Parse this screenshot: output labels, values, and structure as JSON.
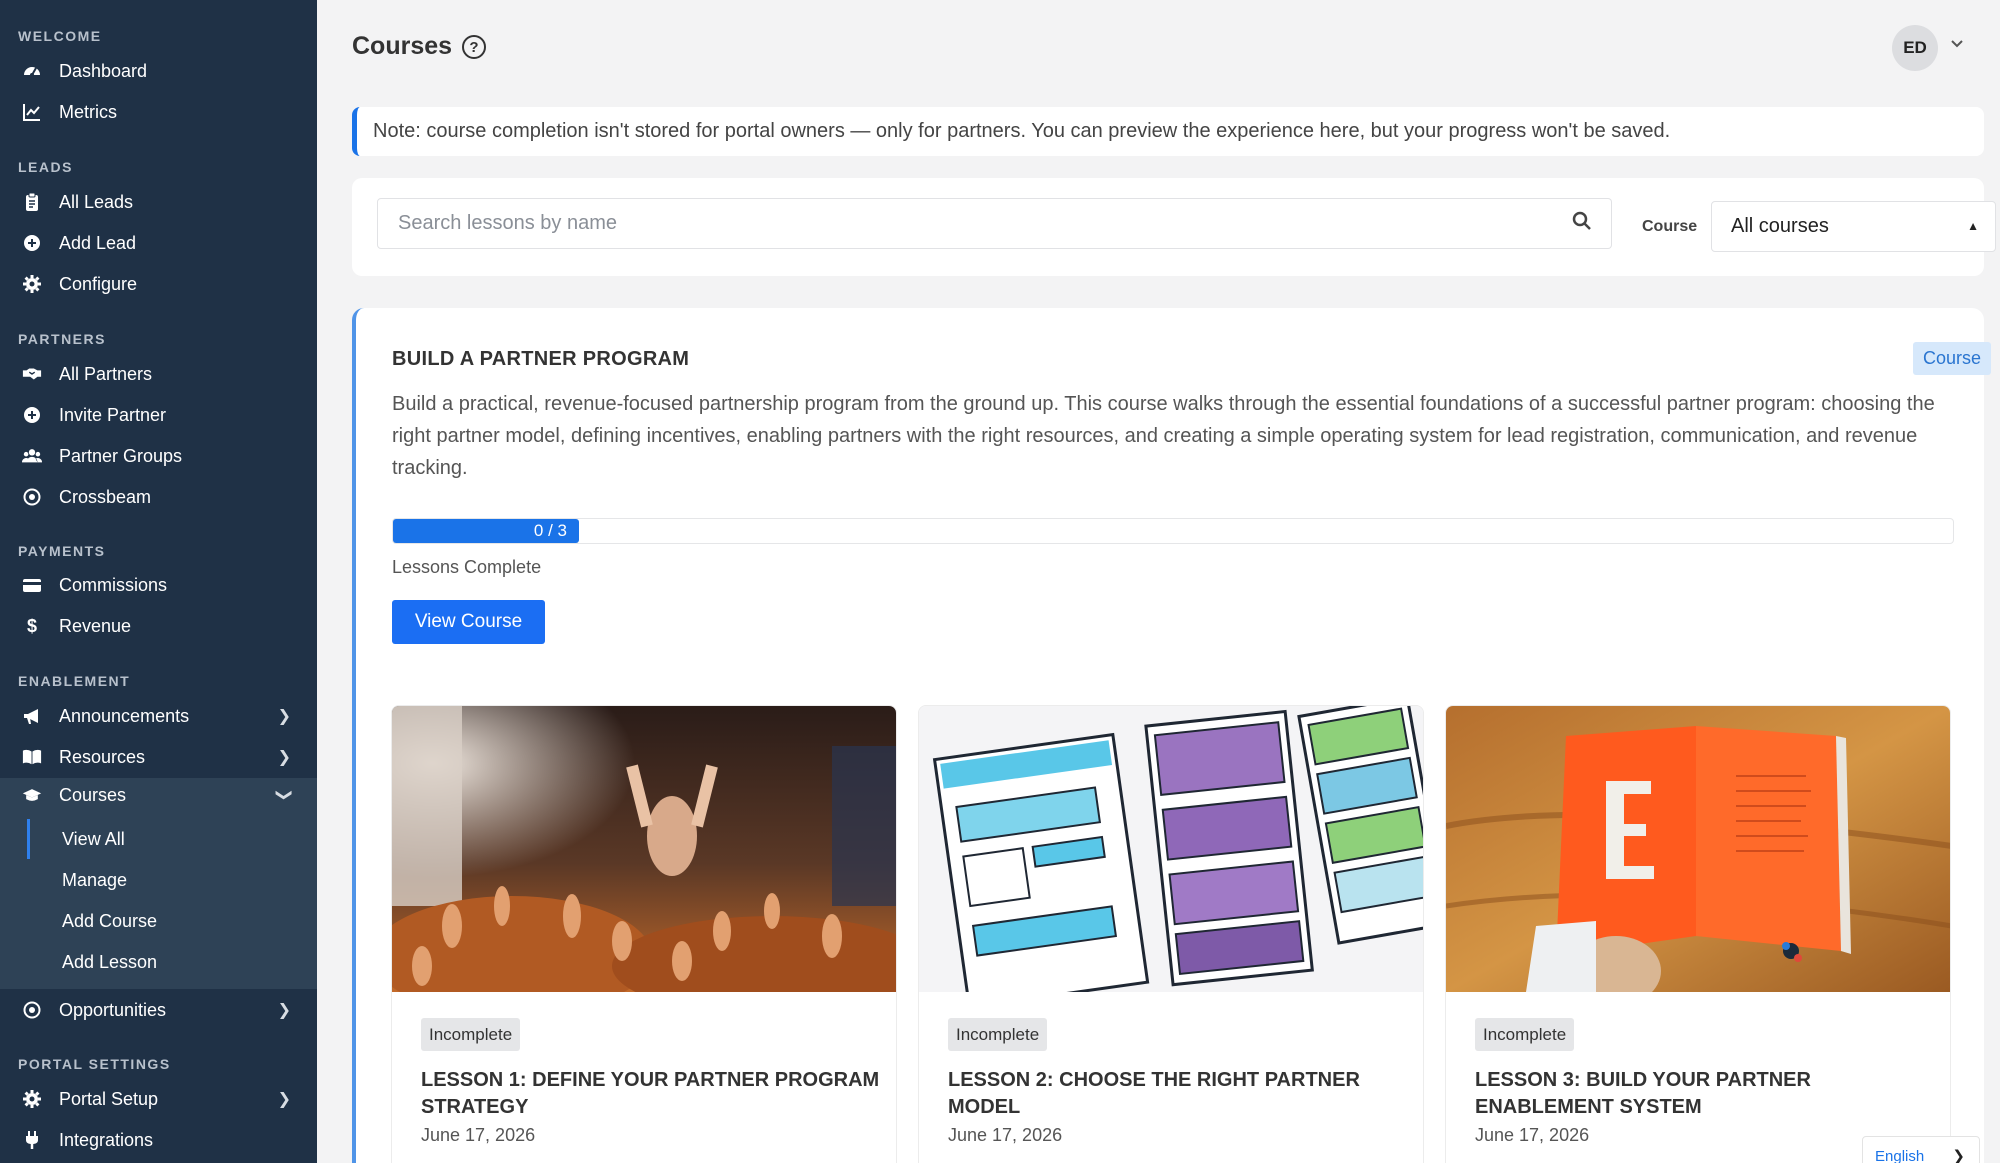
{
  "sidebar": {
    "sections": [
      {
        "title": "WELCOME",
        "items": [
          {
            "label": "Dashboard",
            "icon": "dashboard-icon"
          },
          {
            "label": "Metrics",
            "icon": "chart-line-icon"
          }
        ]
      },
      {
        "title": "LEADS",
        "items": [
          {
            "label": "All Leads",
            "icon": "clipboard-icon"
          },
          {
            "label": "Add Lead",
            "icon": "plus-circle-icon"
          },
          {
            "label": "Configure",
            "icon": "gear-icon"
          }
        ]
      },
      {
        "title": "PARTNERS",
        "items": [
          {
            "label": "All Partners",
            "icon": "handshake-icon"
          },
          {
            "label": "Invite Partner",
            "icon": "plus-circle-icon"
          },
          {
            "label": "Partner Groups",
            "icon": "users-icon"
          },
          {
            "label": "Crossbeam",
            "icon": "target-icon"
          }
        ]
      },
      {
        "title": "PAYMENTS",
        "items": [
          {
            "label": "Commissions",
            "icon": "credit-card-icon"
          },
          {
            "label": "Revenue",
            "icon": "dollar-icon"
          }
        ]
      },
      {
        "title": "ENABLEMENT",
        "items": [
          {
            "label": "Announcements",
            "icon": "megaphone-icon"
          },
          {
            "label": "Resources",
            "icon": "book-icon"
          },
          {
            "label": "Courses",
            "icon": "graduation-cap-icon"
          },
          {
            "label": "Opportunities",
            "icon": "target-icon"
          }
        ]
      },
      {
        "title": "PORTAL SETTINGS",
        "items": [
          {
            "label": "Portal Setup",
            "icon": "gear-icon"
          },
          {
            "label": "Integrations",
            "icon": "plug-icon"
          }
        ]
      }
    ],
    "courses_submenu": [
      "View All",
      "Manage",
      "Add Course",
      "Add Lesson"
    ],
    "active_item": "Courses",
    "active_subitem": "View All"
  },
  "header": {
    "title": "Courses",
    "help_icon": "question-circle-icon",
    "avatar_initials": "ED"
  },
  "note": {
    "text": "Note: course completion isn't stored for portal owners — only for partners. You can preview the experience here, but your progress won't be saved."
  },
  "filters": {
    "search_placeholder": "Search lessons by name",
    "search_value": "",
    "course_label": "Course",
    "course_selected": "All courses"
  },
  "course": {
    "title": "BUILD A PARTNER PROGRAM",
    "badge": "Course",
    "description": "Build a practical, revenue-focused partnership program from the ground up. This course walks through the essential foundations of a successful partner program: choosing the right partner model, defining incentives, enabling partners with the right resources, and creating a simple operating system for lead registration, communication, and revenue tracking.",
    "progress_label": "0 / 3",
    "progress_completed": 0,
    "progress_total": 3,
    "progress_caption": "Lessons Complete",
    "button_label": "View Course"
  },
  "lessons": [
    {
      "status": "Incomplete",
      "title": "LESSON 1: DEFINE YOUR PARTNER PROGRAM STRATEGY",
      "date": "June 17, 2026"
    },
    {
      "status": "Incomplete",
      "title": "LESSON 2: CHOOSE THE RIGHT PARTNER MODEL",
      "date": "June 17, 2026"
    },
    {
      "status": "Incomplete",
      "title": "LESSON 3: BUILD YOUR PARTNER ENABLEMENT SYSTEM",
      "date": "June 17, 2026"
    }
  ],
  "language": {
    "label": "English"
  },
  "colors": {
    "sidebar_bg": "#1f3146",
    "sidebar_active_bg": "#2e4256",
    "accent": "#1a73e8",
    "badge_bg": "#d6e8fb",
    "page_bg": "#f3f3f4"
  }
}
